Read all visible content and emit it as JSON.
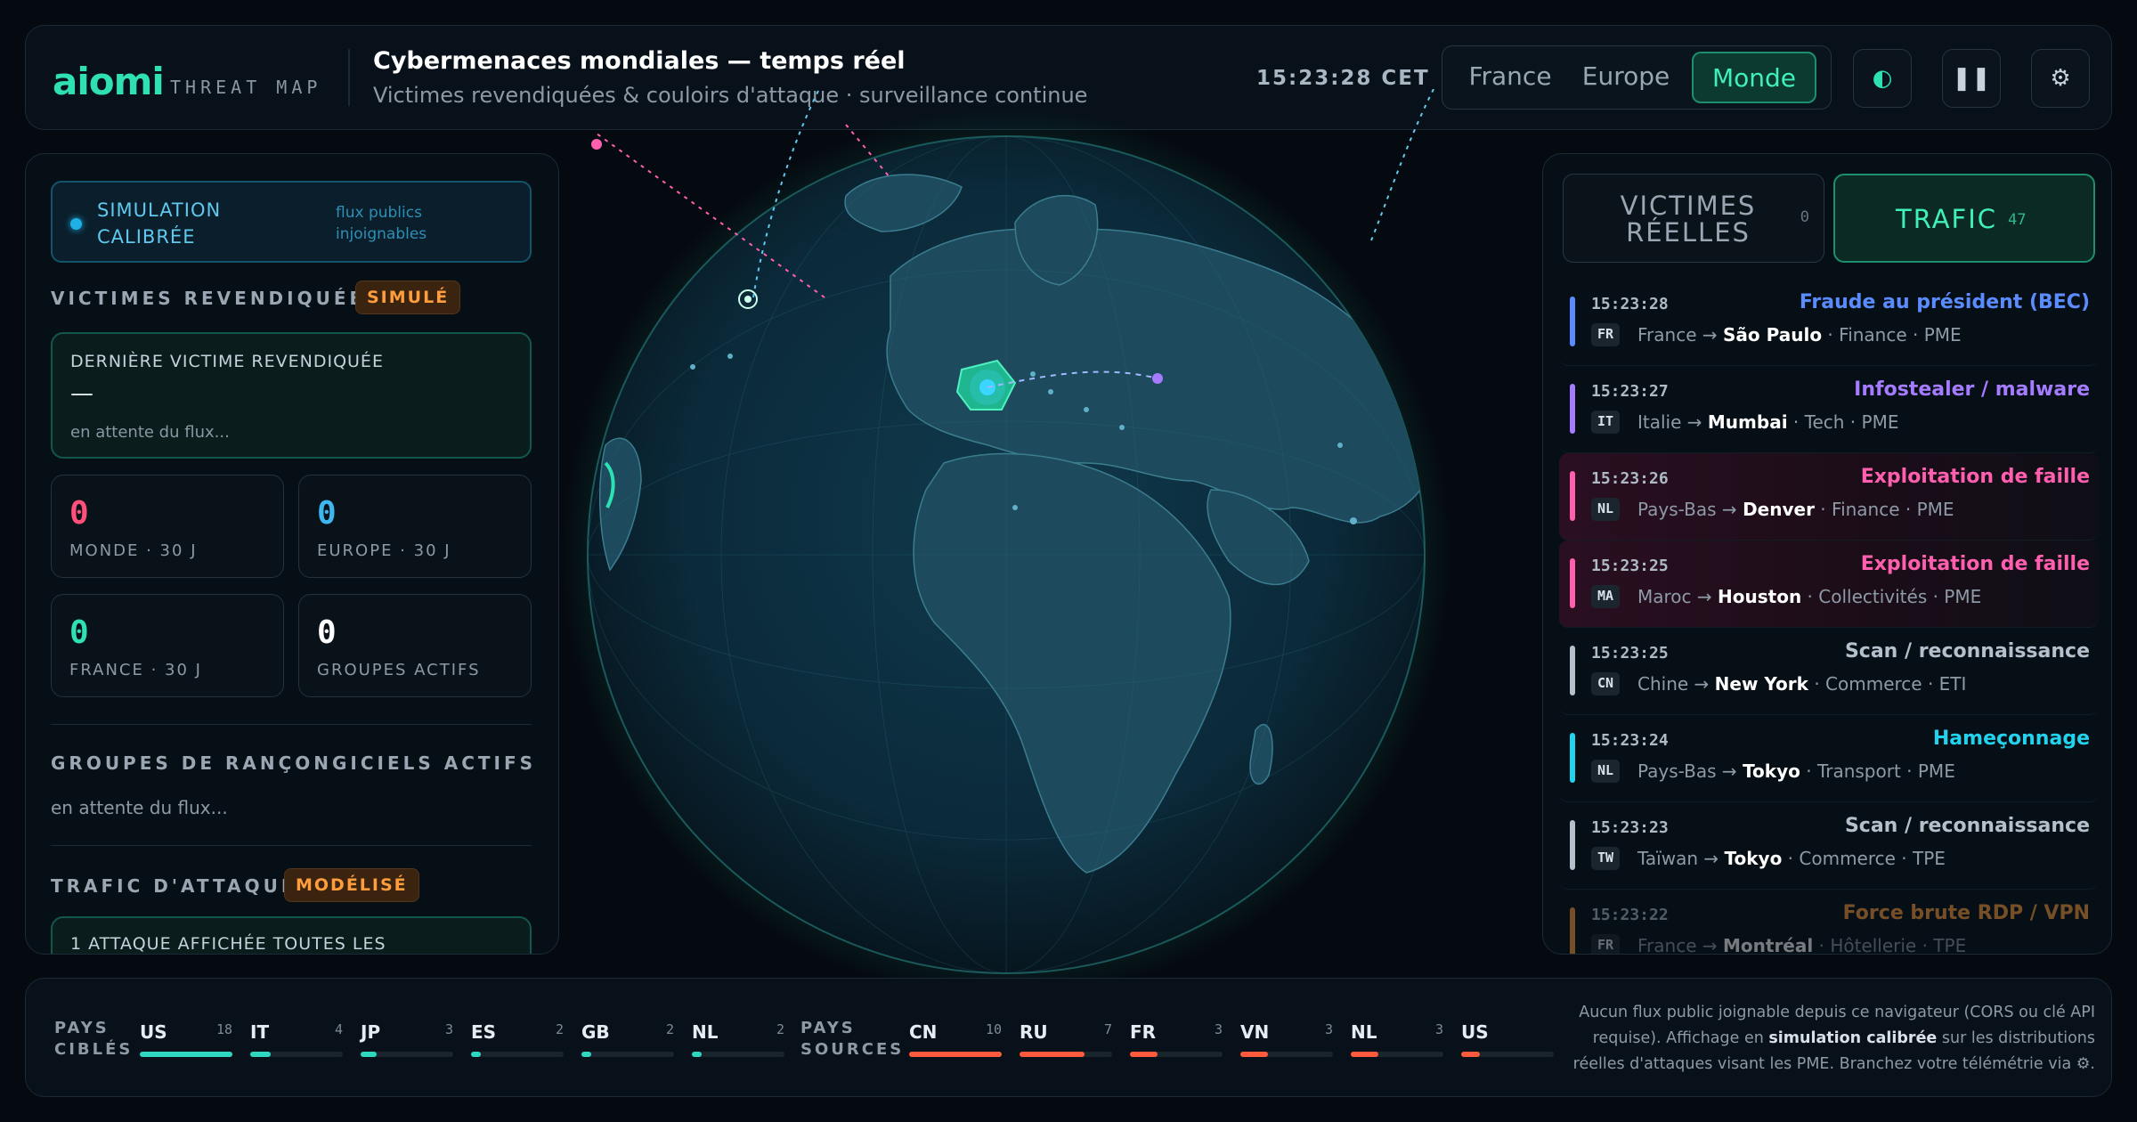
{
  "header": {
    "logo": "aiomi",
    "logo_sub": "THREAT MAP",
    "title": "Cybermenaces mondiales — temps réel",
    "subtitle": "Victimes revendiquées & couloirs d'attaque · surveillance continue",
    "clock": "15:23:28 CET",
    "scope_options": [
      "France",
      "Europe",
      "Monde"
    ],
    "scope_selected": "Monde",
    "icons": [
      "contrast-icon",
      "pause-icon",
      "gear-icon"
    ]
  },
  "left": {
    "sim_label": "SIMULATION CALIBRÉE",
    "sim_note": "flux publics injoignables",
    "victims_title": "VICTIMES REVENDIQUÉES",
    "victims_badge": "SIMULÉ",
    "last_label": "DERNIÈRE VICTIME REVENDIQUÉE",
    "last_value": "—",
    "last_wait": "en attente du flux...",
    "stats": [
      {
        "value": "0",
        "label": "MONDE · 30 J",
        "color": "#ff4f7b"
      },
      {
        "value": "0",
        "label": "EUROPE · 30 J",
        "color": "#3fb6f0"
      },
      {
        "value": "0",
        "label": "FRANCE · 30 J",
        "color": "#2fe0b3"
      },
      {
        "value": "0",
        "label": "GROUPES ACTIFS",
        "color": "#ffffff"
      }
    ],
    "groups_title": "GROUPES DE RANÇONGICIELS ACTIFS",
    "groups_wait": "en attente du flux...",
    "traffic_title": "TRAFIC D'ATTAQUE",
    "traffic_badge": "MODÉLISÉ",
    "traffic_box": "1 ATTAQUE AFFICHÉE TOUTES LES"
  },
  "right": {
    "tab_real_label": "VICTIMES RÉELLES",
    "tab_real_count": "0",
    "tab_traffic_label": "TRAFIC",
    "tab_traffic_count": "47",
    "feed": [
      {
        "time": "15:23:28",
        "type": "Fraude au président (BEC)",
        "color": "#5b8cff",
        "cc": "FR",
        "from": "France",
        "to": "São Paulo",
        "meta": "Finance · PME",
        "hot": false
      },
      {
        "time": "15:23:27",
        "type": "Infostealer / malware",
        "color": "#a57bff",
        "cc": "IT",
        "from": "Italie",
        "to": "Mumbai",
        "meta": "Tech · PME",
        "hot": false
      },
      {
        "time": "15:23:26",
        "type": "Exploitation de faille",
        "color": "#ff5fae",
        "cc": "NL",
        "from": "Pays-Bas",
        "to": "Denver",
        "meta": "Finance · PME",
        "hot": true
      },
      {
        "time": "15:23:25",
        "type": "Exploitation de faille",
        "color": "#ff5fae",
        "cc": "MA",
        "from": "Maroc",
        "to": "Houston",
        "meta": "Collectivités · PME",
        "hot": true
      },
      {
        "time": "15:23:25",
        "type": "Scan / reconnaissance",
        "color": "#b4c0cc",
        "cc": "CN",
        "from": "Chine",
        "to": "New York",
        "meta": "Commerce · ETI",
        "hot": false
      },
      {
        "time": "15:23:24",
        "type": "Hameçonnage",
        "color": "#22d3ee",
        "cc": "NL",
        "from": "Pays-Bas",
        "to": "Tokyo",
        "meta": "Transport · PME",
        "hot": false
      },
      {
        "time": "15:23:23",
        "type": "Scan / reconnaissance",
        "color": "#b4c0cc",
        "cc": "TW",
        "from": "Taïwan",
        "to": "Tokyo",
        "meta": "Commerce · TPE",
        "hot": false
      },
      {
        "time": "15:23:22",
        "type": "Force brute RDP / VPN",
        "color": "#ff9d3c",
        "cc": "FR",
        "from": "France",
        "to": "Montréal",
        "meta": "Hôtellerie · TPE",
        "hot": false
      }
    ]
  },
  "bottom": {
    "targets_label": "PAYS CIBLÉS",
    "targets": [
      {
        "code": "US",
        "count": 18,
        "pct": 100
      },
      {
        "code": "IT",
        "count": 4,
        "pct": 22
      },
      {
        "code": "JP",
        "count": 3,
        "pct": 17
      },
      {
        "code": "ES",
        "count": 2,
        "pct": 11
      },
      {
        "code": "GB",
        "count": 2,
        "pct": 11
      },
      {
        "code": "NL",
        "count": 2,
        "pct": 11
      }
    ],
    "sources_label": "PAYS SOURCES",
    "sources": [
      {
        "code": "CN",
        "count": 10,
        "pct": 100
      },
      {
        "code": "RU",
        "count": 7,
        "pct": 70
      },
      {
        "code": "FR",
        "count": 3,
        "pct": 30
      },
      {
        "code": "VN",
        "count": 3,
        "pct": 30
      },
      {
        "code": "NL",
        "count": 3,
        "pct": 30
      },
      {
        "code": "US",
        "count": "",
        "pct": 20
      }
    ],
    "note_1": "Aucun flux public joignable depuis ce navigateur (CORS ou clé API requise). Affichage en ",
    "note_bold": "simulation calibrée",
    "note_2": " sur les distributions réelles d'attaques visant les PME. Branchez votre télémétrie via ⚙."
  },
  "colors": {
    "accent": "#2fe0b3",
    "target_bar": "#2fd6c0",
    "source_bar": "#ff5a3c"
  }
}
